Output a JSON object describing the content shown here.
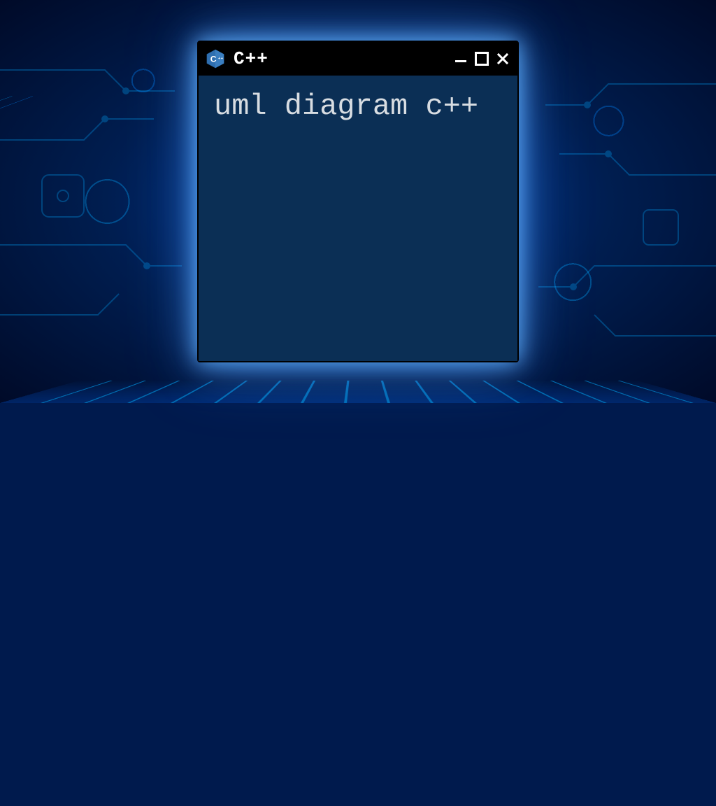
{
  "window": {
    "title": "C++",
    "icon_label": "C++",
    "body_text": "uml diagram c++"
  },
  "controls": {
    "minimize": "minimize",
    "maximize": "maximize",
    "close": "close"
  },
  "colors": {
    "window_bg": "#0b2f55",
    "titlebar_bg": "#000000",
    "text": "#d8dde2",
    "glow": "#4fb0ff"
  }
}
